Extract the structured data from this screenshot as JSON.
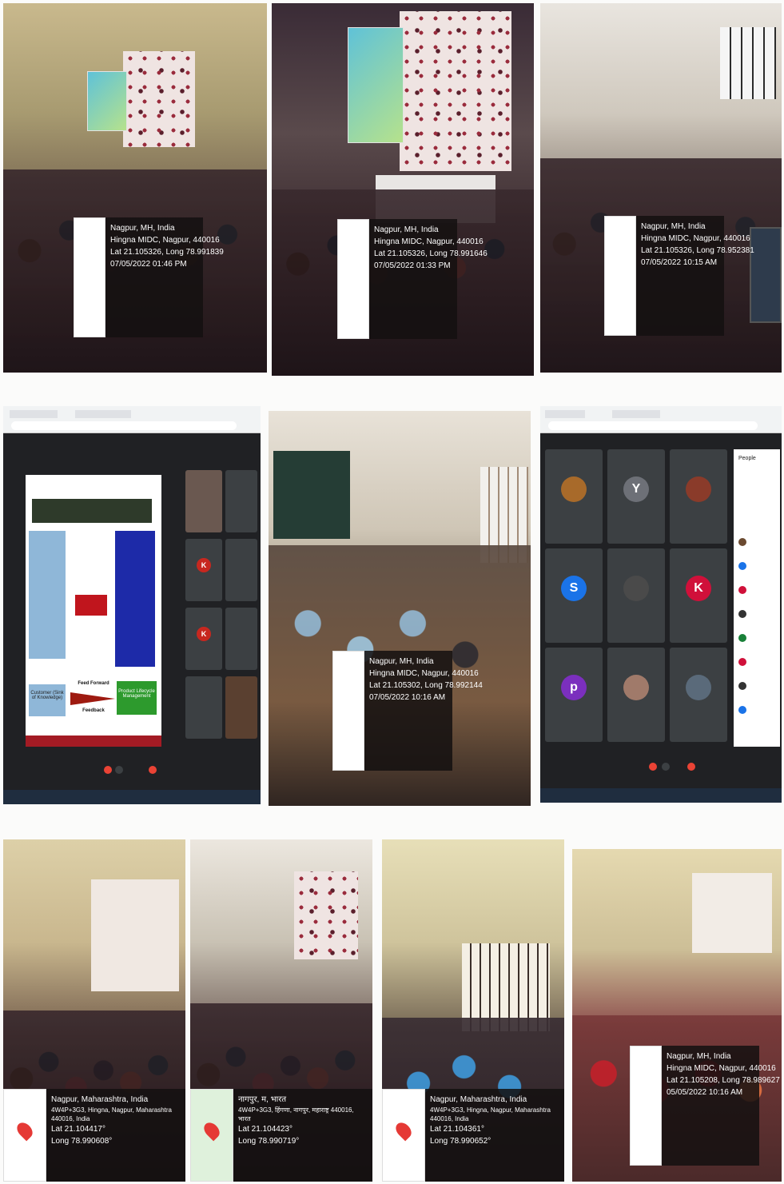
{
  "collage": {
    "rows": [
      {
        "photos": [
          {
            "name": "seminar-hall-photo-1",
            "geotag": {
              "line1": "Nagpur, MH, India",
              "line2": "Hingna MIDC, Nagpur, 440016",
              "line3": "Lat 21.105326, Long 78.991839",
              "line4": "07/05/2022 01:46 PM"
            }
          },
          {
            "name": "seminar-hall-photo-2",
            "geotag": {
              "line1": "Nagpur, MH, India",
              "line2": "Hingna MIDC, Nagpur, 440016",
              "line3": "Lat 21.105326, Long 78.991646",
              "line4": "07/05/2022 01:33 PM"
            }
          },
          {
            "name": "classroom-photo-3",
            "geotag": {
              "line1": "Nagpur, MH, India",
              "line2": "Hingna MIDC, Nagpur, 440016",
              "line3": "Lat 21.105326, Long 78.952381",
              "line4": "07/05/2022 10:15 AM"
            }
          }
        ]
      },
      {
        "photos": [
          {
            "name": "online-meeting-screenshot-1",
            "slide": {
              "lower_left": "Customer (Sink of Knowledge)",
              "arrow_top": "Feed Forward",
              "arrow_bottom": "Feedback",
              "lower_right": "Product Lifecycle Management"
            }
          },
          {
            "name": "classroom-photo-4",
            "geotag": {
              "line1": "Nagpur, MH, India",
              "line2": "Hingna MIDC, Nagpur, 440016",
              "line3": "Lat 21.105302, Long 78.992144",
              "line4": "07/05/2022 10:16 AM"
            }
          },
          {
            "name": "online-meeting-screenshot-2",
            "panel_title": "People",
            "tiles": [
              {
                "letter": "",
                "color": "#a86a2a"
              },
              {
                "letter": "Y",
                "color": "#6d7077"
              },
              {
                "letter": "",
                "color": "#8a3b2a"
              },
              {
                "letter": "S",
                "color": "#1a73e8"
              },
              {
                "letter": "",
                "color": "#4a4a4a"
              },
              {
                "letter": "K",
                "color": "#d0103a"
              },
              {
                "letter": "p",
                "color": "#7b2fbe"
              },
              {
                "letter": "",
                "color": "#a07a6a"
              },
              {
                "letter": "",
                "color": "#5a6a7a"
              }
            ]
          }
        ]
      },
      {
        "photos": [
          {
            "name": "hall-photo-5",
            "geotag": {
              "line1": "Nagpur, Maharashtra, India",
              "line2": "4W4P+3G3, Hingna, Nagpur, Maharashtra 440016, India",
              "line3": "Lat 21.104417°",
              "line4": "Long 78.990608°"
            }
          },
          {
            "name": "hall-photo-6",
            "geotag": {
              "line1": "नागपुर, म, भारत",
              "line2": "4W4P+3G3, हिंगणा, नागपुर, महाराष्ट्र 440016, भारत",
              "line3": "Lat 21.104423°",
              "line4": "Long 78.990719°"
            }
          },
          {
            "name": "hall-photo-7",
            "geotag": {
              "line1": "Nagpur, Maharashtra, India",
              "line2": "4W4P+3G3, Hingna, Nagpur, Maharashtra 440016, India",
              "line3": "Lat 21.104361°",
              "line4": "Long 78.990652°"
            }
          },
          {
            "name": "hall-photo-8",
            "geotag": {
              "line1": "Nagpur, MH, India",
              "line2": "Hingna MIDC, Nagpur, 440016",
              "line3": "Lat 21.105208, Long 78.989627",
              "line4": "05/05/2022 10:16 AM"
            }
          }
        ]
      }
    ]
  }
}
